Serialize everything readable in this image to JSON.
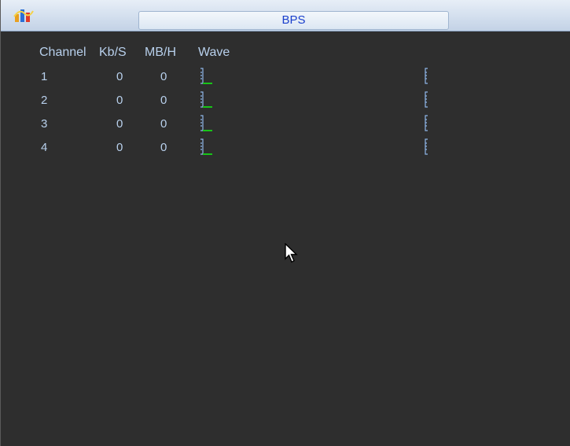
{
  "window": {
    "title": "BPS",
    "app_icon": "dvr-logo-icon"
  },
  "table": {
    "headers": {
      "channel": "Channel",
      "kbs": "Kb/S",
      "mbh": "MB/H",
      "wave": "Wave"
    },
    "rows": [
      {
        "channel": "1",
        "kbs": "0",
        "mbh": "0"
      },
      {
        "channel": "2",
        "kbs": "0",
        "mbh": "0"
      },
      {
        "channel": "3",
        "kbs": "0",
        "mbh": "0"
      },
      {
        "channel": "4",
        "kbs": "0",
        "mbh": "0"
      }
    ]
  },
  "colors": {
    "background": "#2e2e2e",
    "text": "#b8d0ec",
    "title_text": "#1a3fcc",
    "wave_baseline": "#18c418",
    "wave_scale": "#8fb6e8"
  }
}
